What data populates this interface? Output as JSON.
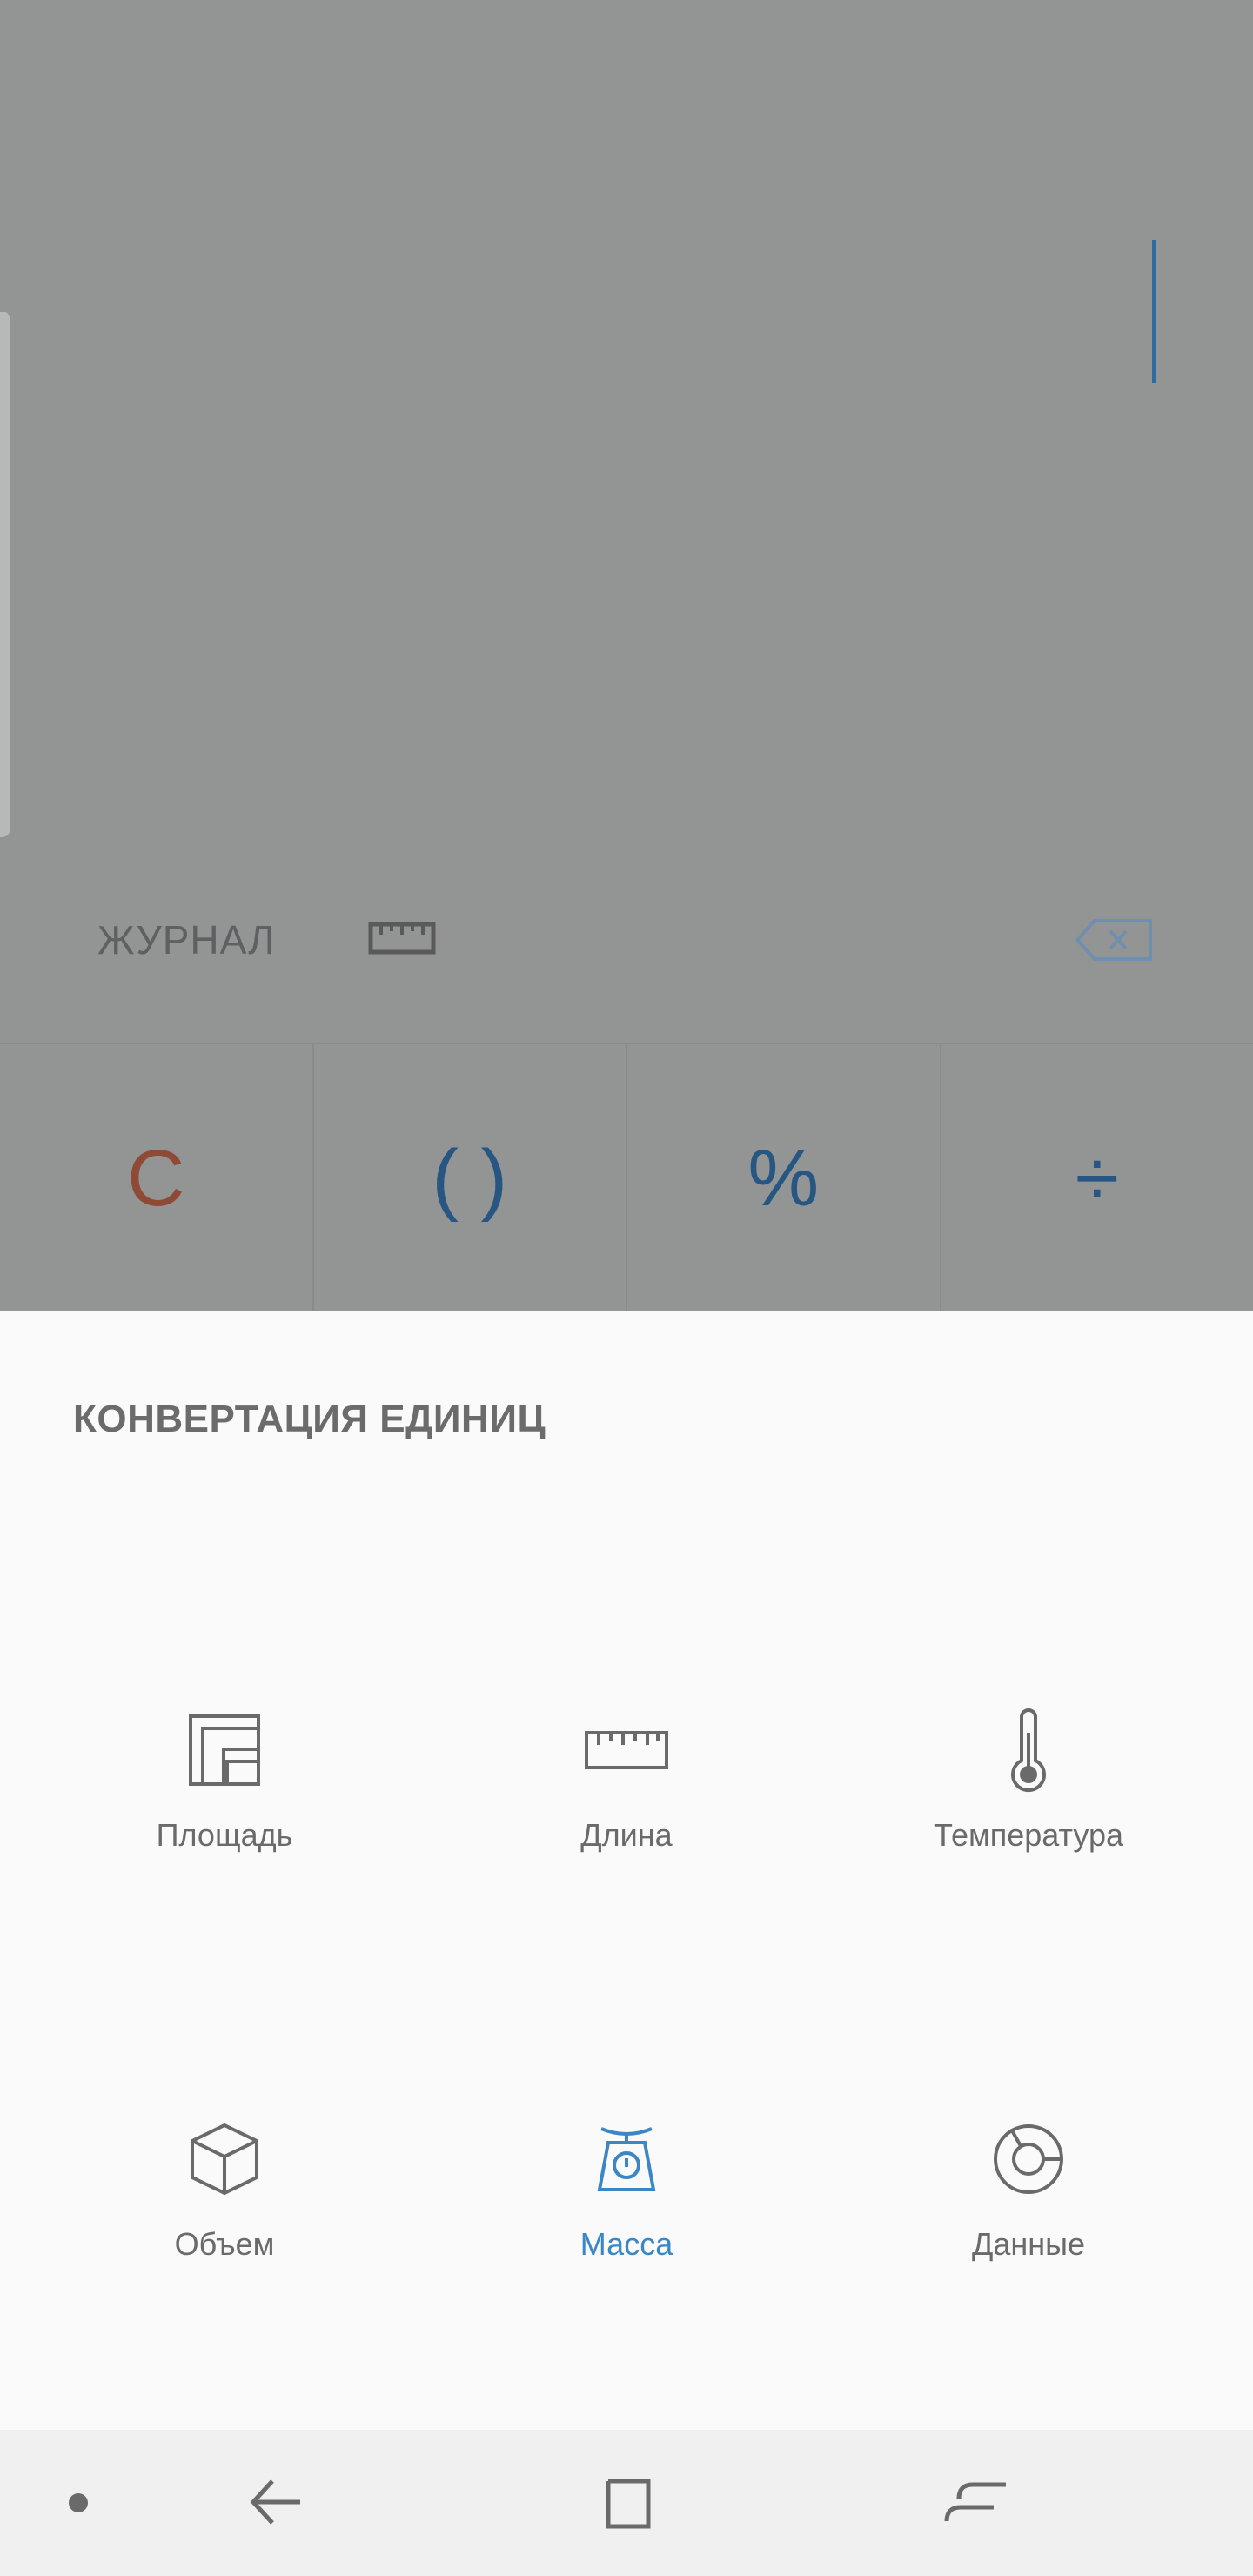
{
  "calculator": {
    "history_label": "ЖУРНАЛ",
    "keys": [
      "C",
      "( )",
      "%",
      "÷"
    ]
  },
  "sheet": {
    "title": "КОНВЕРТАЦИЯ ЕДИНИЦ",
    "items": [
      {
        "label": "Площадь",
        "icon": "area-icon"
      },
      {
        "label": "Длина",
        "icon": "ruler-icon"
      },
      {
        "label": "Температура",
        "icon": "thermometer-icon"
      },
      {
        "label": "Объем",
        "icon": "cube-icon"
      },
      {
        "label": "Масса",
        "icon": "scale-icon",
        "selected": true
      },
      {
        "label": "Данные",
        "icon": "data-icon"
      }
    ]
  },
  "colors": {
    "accent": "#3b86c5",
    "clear_key": "#8f4a35",
    "operator_key": "#275683"
  }
}
